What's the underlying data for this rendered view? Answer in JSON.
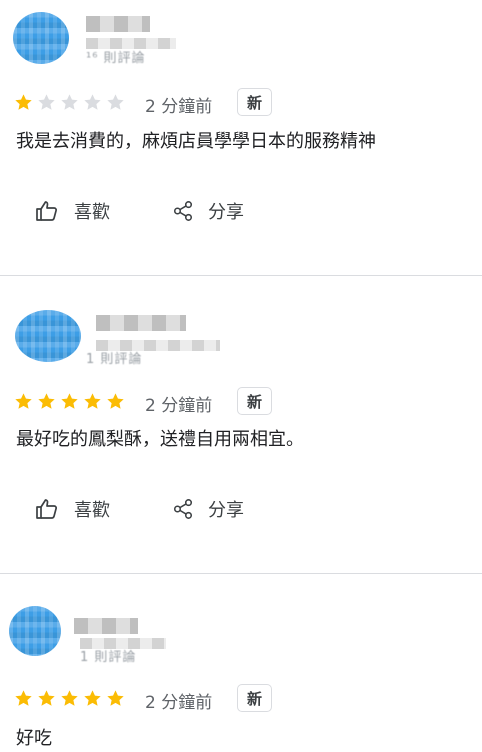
{
  "reviews": [
    {
      "sub": "¹⁶ 則評論",
      "rating": 1,
      "time": "2 分鐘前",
      "badge": "新",
      "text": "我是去消費的，麻煩店員學學日本的服務精神",
      "like_label": "喜歡",
      "share_label": "分享"
    },
    {
      "sub": "1 則評論",
      "rating": 5,
      "time": "2 分鐘前",
      "badge": "新",
      "text": "最好吃的鳳梨酥，送禮自用兩相宜。",
      "like_label": "喜歡",
      "share_label": "分享"
    },
    {
      "sub": "1 則評論",
      "rating": 5,
      "time": "2 分鐘前",
      "badge": "新",
      "text": "好吃"
    }
  ],
  "colors": {
    "star_filled": "#fbbc04",
    "star_empty": "#dadce0"
  },
  "icons": {
    "like": "thumb-up-icon",
    "share": "share-icon",
    "star": "star-icon"
  }
}
